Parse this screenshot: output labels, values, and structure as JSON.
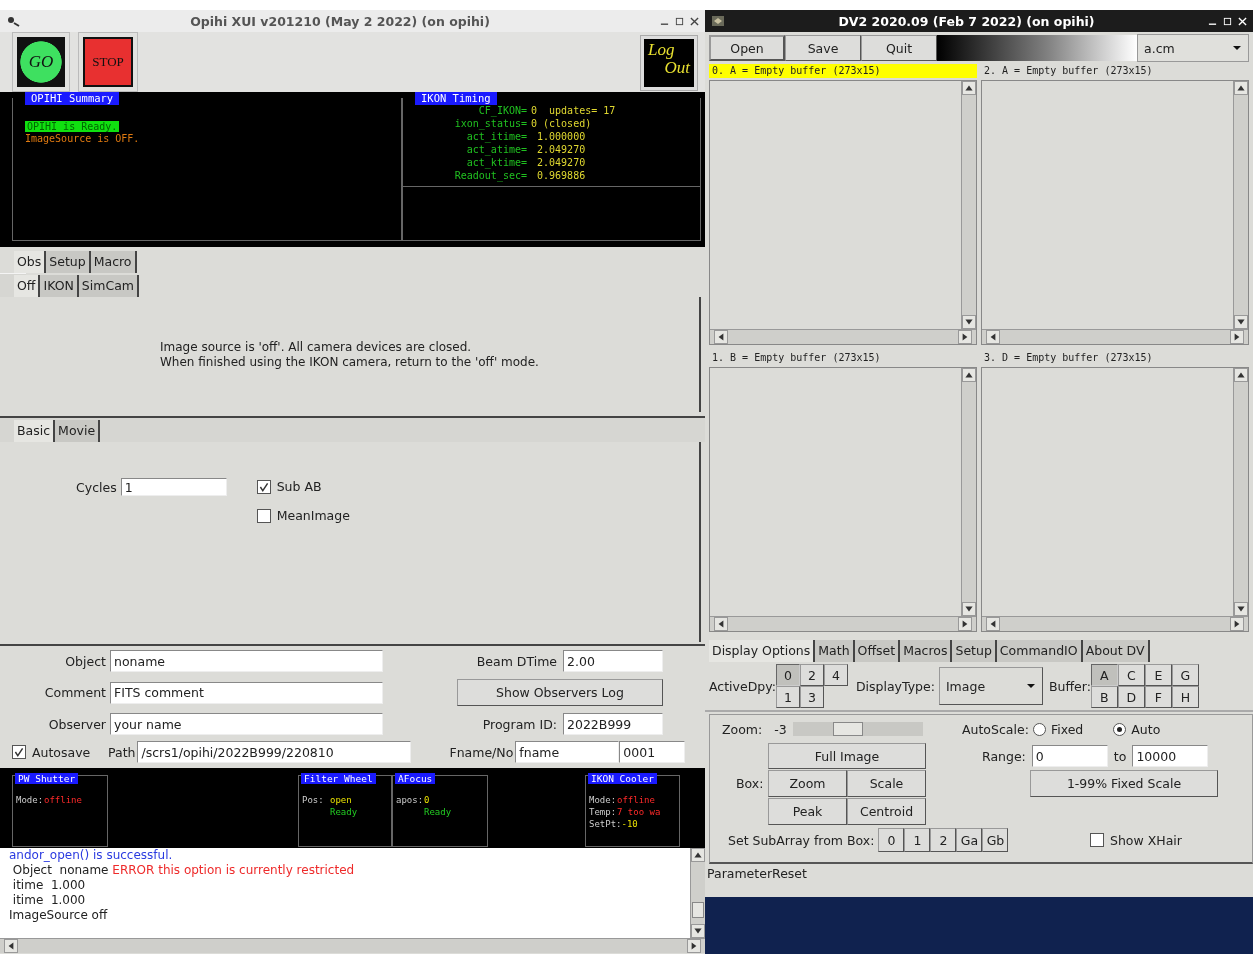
{
  "left_window": {
    "title": "Opihi XUI v201210 (May  2 2022) (on opihi)",
    "toolbar": {
      "go": "GO",
      "stop": "STOP",
      "logout_lines": [
        "Log",
        "Out"
      ]
    },
    "summary": {
      "title": "OPIHI Summary",
      "lines": [
        {
          "text": "OPIHI is Ready.",
          "kind": "ready"
        },
        {
          "text": "ImageSource is OFF.",
          "kind": "warning"
        }
      ]
    },
    "ikon_timing": {
      "title": "IKON Timing",
      "lines": [
        {
          "label": "CF_IKON=",
          "value": "0  updates= 17"
        },
        {
          "label": "ixon_status=",
          "value": "0 (closed)"
        },
        {
          "label": "act_itime=",
          "value": " 1.000000"
        },
        {
          "label": "act_atime=",
          "value": " 2.049270"
        },
        {
          "label": "act_ktime=",
          "value": " 2.049270"
        },
        {
          "label": "Readout_sec=",
          "value": " 0.969886"
        }
      ]
    },
    "main_tabs": [
      {
        "label": "Obs",
        "selected": true
      },
      {
        "label": "Setup",
        "selected": false
      },
      {
        "label": "Macro",
        "selected": false
      }
    ],
    "source_tabs": [
      {
        "label": "Off",
        "selected": true
      },
      {
        "label": "IKON",
        "selected": false
      },
      {
        "label": "SimCam",
        "selected": false
      }
    ],
    "source_message": [
      "Image source is 'off'. All camera devices are closed.",
      "When finished using the IKON camera, return to the 'off' mode."
    ],
    "mode_tabs": [
      {
        "label": "Basic",
        "selected": true
      },
      {
        "label": "Movie",
        "selected": false
      }
    ],
    "basic": {
      "cycles_label": "Cycles",
      "cycles_value": "1",
      "checkboxes": [
        {
          "label": "Sub AB",
          "checked": true
        },
        {
          "label": "MeanImage",
          "checked": false
        }
      ]
    },
    "form": {
      "object_label": "Object",
      "object_value": "noname",
      "comment_label": "Comment",
      "comment_value": "FITS comment",
      "observer_label": "Observer",
      "observer_value": "your name",
      "autosave": {
        "label": "Autosave",
        "checked": true
      },
      "path_label": "Path",
      "path_value": "/scrs1/opihi/2022B999/220810",
      "beam_label": "Beam DTime",
      "beam_value": "2.00",
      "observers_log_button": "Show Observers Log",
      "program_label": "Program ID:",
      "program_value": "2022B999",
      "fname_label": "Fname/No",
      "fname_value": "fname",
      "number_value": "0001"
    },
    "status_panels": [
      {
        "title": "PW Shutter",
        "lines": [
          {
            "label": "Mode:",
            "value": "offline",
            "kind": "error"
          }
        ]
      },
      {
        "title": "Filter Wheel",
        "lines": [
          {
            "label": "Pos:",
            "value": "open",
            "kind": "value"
          },
          {
            "value": "Ready",
            "kind": "ok"
          }
        ]
      },
      {
        "title": "AFocus",
        "lines": [
          {
            "label": "apos:",
            "value": "0",
            "kind": "value"
          },
          {
            "value": "Ready",
            "kind": "ok"
          }
        ]
      },
      {
        "title": "IKON Cooler",
        "lines": [
          {
            "label": "Mode:",
            "value": "offline",
            "kind": "error"
          },
          {
            "label": "Temp:",
            "value": "7 too wa",
            "kind": "error"
          },
          {
            "label": "SetPt:",
            "value": "-10",
            "kind": "value"
          }
        ]
      }
    ],
    "log": [
      {
        "segments": [
          {
            "text": "andor_open() is successful.",
            "kind": "info"
          }
        ]
      },
      {
        "segments": [
          {
            "text": " Object  noname ",
            "kind": "normal"
          },
          {
            "text": "ERROR this option is currently restricted",
            "kind": "error"
          }
        ]
      },
      {
        "segments": [
          {
            "text": " itime  1.000",
            "kind": "normal"
          }
        ]
      },
      {
        "segments": [
          {
            "text": " itime  1.000",
            "kind": "normal"
          }
        ]
      },
      {
        "segments": [
          {
            "text": "ImageSource off",
            "kind": "normal"
          }
        ]
      }
    ]
  },
  "right_window": {
    "title": "DV2 2020.09 (Feb  7 2022) (on opihi)",
    "toolbar_buttons": [
      "Open",
      "Save",
      "Quit"
    ],
    "colormap": "a.cm",
    "buffers": [
      {
        "label": "0. A = Empty buffer (273x15)",
        "selected": true
      },
      {
        "label": "2. A = Empty buffer (273x15)",
        "selected": false
      },
      {
        "label": "1. B = Empty buffer (273x15)",
        "selected": false
      },
      {
        "label": "3. D = Empty buffer (273x15)",
        "selected": false
      }
    ],
    "tabs": [
      {
        "label": "Display Options",
        "selected": true
      },
      {
        "label": "Math",
        "selected": false
      },
      {
        "label": "Offset",
        "selected": false
      },
      {
        "label": "Macros",
        "selected": false
      },
      {
        "label": "Setup",
        "selected": false
      },
      {
        "label": "CommandIO",
        "selected": false
      },
      {
        "label": "About DV",
        "selected": false
      }
    ],
    "active_dpy_label": "ActiveDpy:",
    "active_dpy": [
      {
        "label": "0",
        "selected": true
      },
      {
        "label": "2",
        "selected": false
      },
      {
        "label": "4",
        "selected": false
      },
      {
        "label": "1",
        "selected": false
      },
      {
        "label": "3",
        "selected": false
      }
    ],
    "display_type_label": "DisplayType:",
    "display_type": "Image",
    "buffer_label": "Buffer:",
    "buffer_buttons": [
      {
        "label": "A",
        "selected": true
      },
      {
        "label": "C",
        "selected": false
      },
      {
        "label": "E",
        "selected": false
      },
      {
        "label": "G",
        "selected": false
      },
      {
        "label": "B",
        "selected": false
      },
      {
        "label": "D",
        "selected": false
      },
      {
        "label": "F",
        "selected": false
      },
      {
        "label": "H",
        "selected": false
      }
    ],
    "zoom": {
      "label": "Zoom:",
      "value": "-3",
      "level": 0.4
    },
    "autoscale": {
      "label": "AutoScale:",
      "options": [
        {
          "label": "Fixed",
          "selected": false
        },
        {
          "label": "Auto",
          "selected": true
        }
      ]
    },
    "range": {
      "label": "Range:",
      "from": "0",
      "to_label": "to",
      "to": "10000"
    },
    "full_image_button": "Full Image",
    "box_label": "Box:",
    "box_buttons": [
      "Zoom",
      "Scale",
      "Peak",
      "Centroid"
    ],
    "fixed_scale_button": "1-99% Fixed Scale",
    "subarray_label": "Set SubArray from Box:",
    "subarray_buttons": [
      "0",
      "1",
      "2",
      "Ga",
      "Gb"
    ],
    "show_xhair": {
      "label": "Show XHair",
      "checked": false
    },
    "status": "ParameterReset"
  }
}
